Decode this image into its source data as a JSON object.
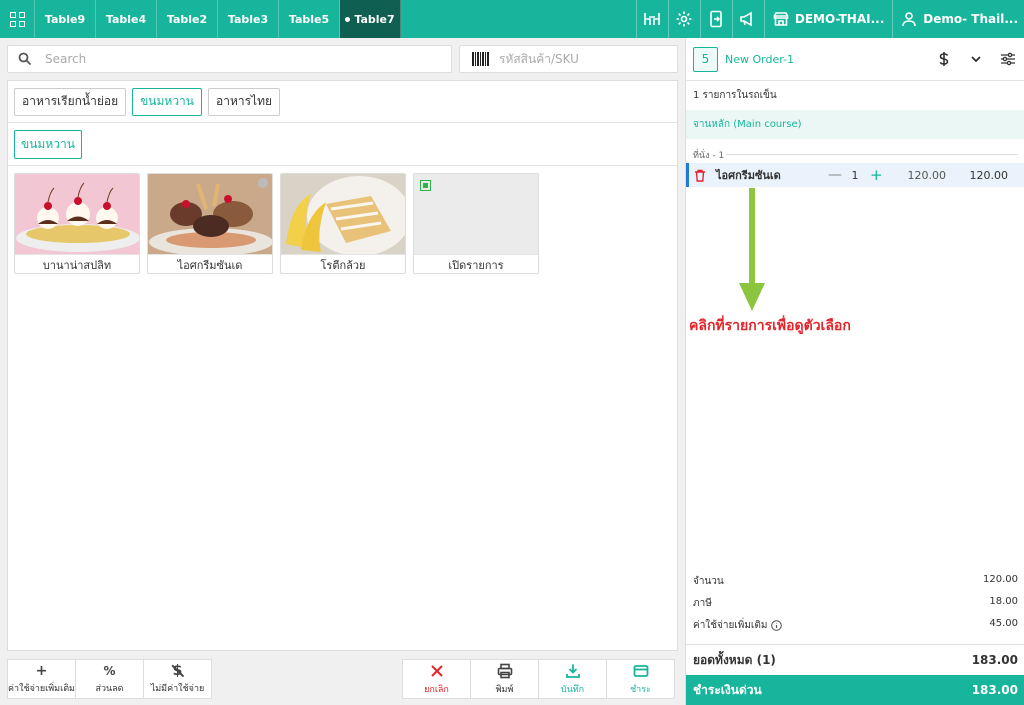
{
  "topbar": {
    "tabs": [
      "Table9",
      "Table4",
      "Table2",
      "Table3",
      "Table5",
      "Table7"
    ],
    "shop_name": "DEMO-THAI...",
    "user_name": "Demo- Thail..."
  },
  "search": {
    "placeholder": "Search",
    "sku_placeholder": "รหัสสินค้า/SKU"
  },
  "categories": [
    "อาหารเรียกน้ำย่อย",
    "ขนมหวาน",
    "อาหารไทย"
  ],
  "subcategory": "ขนมหวาน",
  "products": [
    "บานาน่าสปลิท",
    "ไอศกรีมซันเด",
    "โรตีกล้วย",
    "เปิดรายการ"
  ],
  "bottom_left": [
    "ค่าใช้จ่ายเพิ่มเติม",
    "ส่วนลด",
    "ไม่มีค่าใช้จ่าย"
  ],
  "bottom_right": [
    "ยกเลิก",
    "พิมพ์",
    "บันทึก",
    "ชำระ"
  ],
  "order": {
    "number": "5",
    "name": "New Order-1",
    "count_line": "1 รายการในรถเข็น",
    "course": "จานหลัก (Main course)",
    "seat": "ที่นั่ง - 1",
    "item": {
      "name": "ไอศกรีมซันเด",
      "qty": "1",
      "price": "120.00",
      "total": "120.00"
    },
    "annotation": "คลิกที่รายการเพื่อดูตัวเลือก",
    "summary": [
      {
        "label": "จำนวน",
        "value": "120.00"
      },
      {
        "label": "ภาษี",
        "value": "18.00"
      },
      {
        "label": "ค่าใช้จ่ายเพิ่มเติม",
        "value": "45.00"
      }
    ],
    "grand_label": "ยอดทั้งหมด  (1)",
    "grand_value": "183.00",
    "pay_label": "ชำระเงินด่วน",
    "pay_value": "183.00"
  },
  "colors": {
    "accent": "#17b59b",
    "active_tab": "#0f5f52",
    "annotation": "#e3252b",
    "selected_row": "#1f7ad6"
  }
}
